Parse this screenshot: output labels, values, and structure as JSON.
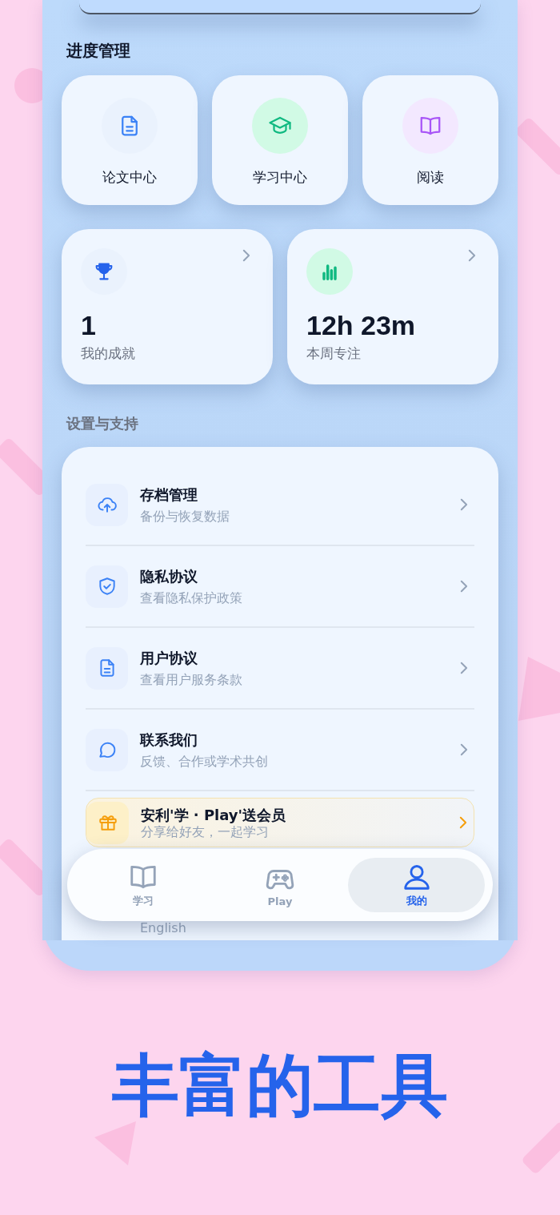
{
  "progress": {
    "title": "进度管理",
    "tiles": [
      {
        "kind": "document",
        "label": "论文中心"
      },
      {
        "kind": "graduation",
        "label": "学习中心"
      },
      {
        "kind": "book",
        "label": "阅读"
      }
    ]
  },
  "stats": [
    {
      "kind": "trophy",
      "value": "1",
      "label": "我的成就"
    },
    {
      "kind": "chart",
      "value": "12h 23m",
      "label": "本周专注"
    }
  ],
  "settings": {
    "title": "设置与支持",
    "items": [
      {
        "kind": "cloud",
        "title": "存档管理",
        "subtitle": "备份与恢复数据"
      },
      {
        "kind": "shield",
        "title": "隐私协议",
        "subtitle": "查看隐私保护政策"
      },
      {
        "kind": "document",
        "title": "用户协议",
        "subtitle": "查看用户服务条款"
      },
      {
        "kind": "chat",
        "title": "联系我们",
        "subtitle": "反馈、合作或学术共创"
      },
      {
        "kind": "gift",
        "title": "安利'学 · Play'送会员",
        "subtitle": "分享给好友，一起学习"
      },
      {
        "kind": "language",
        "subtitle": "English"
      }
    ]
  },
  "nav": [
    {
      "kind": "book",
      "label": "学习",
      "selected": false
    },
    {
      "kind": "gamepad",
      "label": "Play",
      "selected": false
    },
    {
      "kind": "person",
      "label": "我的",
      "selected": true
    }
  ],
  "headline": "丰富的工具"
}
